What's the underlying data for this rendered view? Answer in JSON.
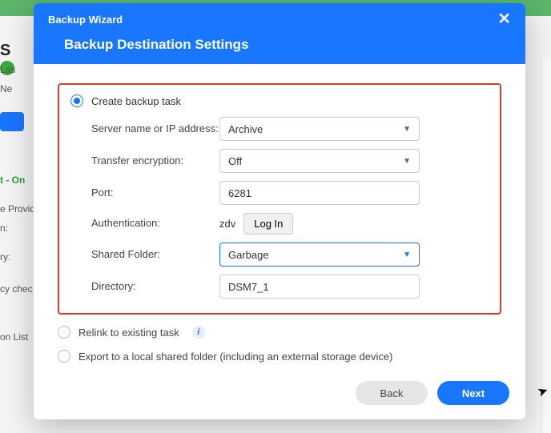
{
  "background": {
    "title_fragment": "S",
    "line1": "Las",
    "line2": "Ne",
    "status": "t - On",
    "provider_fragment": "e Provid",
    "n_fragment": "n:",
    "ry_fragment": "ry:",
    "cy_fragment": "cy chec",
    "list_fragment": "on List"
  },
  "modal": {
    "title": "Backup Wizard",
    "subtitle": "Backup Destination Settings",
    "options": {
      "create": "Create backup task",
      "relink": "Relink to existing task",
      "export": "Export to a local shared folder (including an external storage device)"
    },
    "form": {
      "server_label": "Server name or IP address:",
      "server_value": "Archive",
      "encryption_label": "Transfer encryption:",
      "encryption_value": "Off",
      "port_label": "Port:",
      "port_value": "6281",
      "auth_label": "Authentication:",
      "auth_user": "zdv",
      "auth_button": "Log In",
      "folder_label": "Shared Folder:",
      "folder_value": "Garbage",
      "dir_label": "Directory:",
      "dir_value": "DSM7_1"
    },
    "footer": {
      "back": "Back",
      "next": "Next"
    },
    "icons": {
      "info": "i",
      "close": "✕",
      "caret": "▼"
    }
  }
}
